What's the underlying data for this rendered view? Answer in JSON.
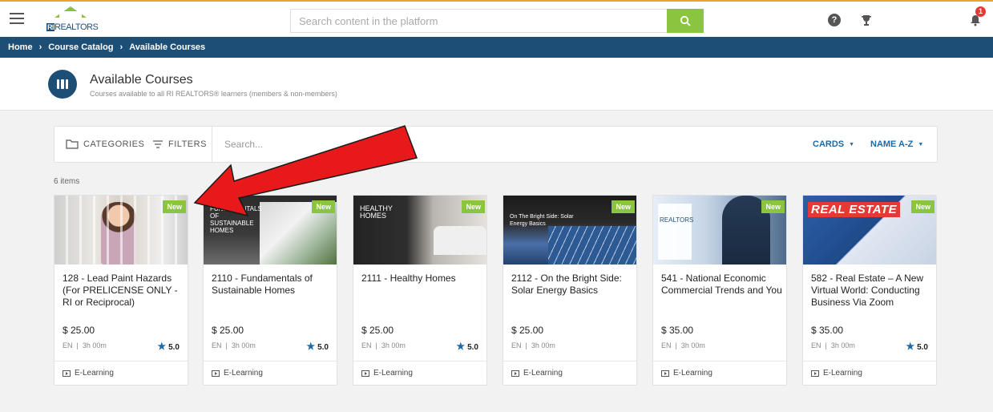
{
  "header": {
    "logo_text": "REALTORS",
    "search_placeholder": "Search content in the platform",
    "notification_count": "1"
  },
  "breadcrumb": [
    "Home",
    "Course Catalog",
    "Available Courses"
  ],
  "page": {
    "title": "Available Courses",
    "subtitle": "Courses available to all RI REALTORS® learners (members & non-members)"
  },
  "toolbar": {
    "categories": "CATEGORIES",
    "filters": "FILTERS",
    "search_placeholder": "Search...",
    "view": "CARDS",
    "sort": "NAME A-Z"
  },
  "items_count": "6 items",
  "cards": [
    {
      "badge": "New",
      "title": "128 - Lead Paint Hazards (For PRELICENSE ONLY - RI or Reciprocal)",
      "price": "$ 25.00",
      "lang": "EN",
      "duration": "3h 00m",
      "rating": "5.0",
      "type": "E-Learning",
      "thumb_text": ""
    },
    {
      "badge": "New",
      "title": "2110 - Fundamentals of Sustainable Homes",
      "price": "$ 25.00",
      "lang": "EN",
      "duration": "3h 00m",
      "rating": "5.0",
      "type": "E-Learning",
      "thumb_text": "Fundamentals of Sustainable Homes"
    },
    {
      "badge": "New",
      "title": "2111 - Healthy Homes",
      "price": "$ 25.00",
      "lang": "EN",
      "duration": "3h 00m",
      "rating": "5.0",
      "type": "E-Learning",
      "thumb_text": "Healthy Homes"
    },
    {
      "badge": "New",
      "title": "2112 - On the Bright Side: Solar Energy Basics",
      "price": "$ 25.00",
      "lang": "EN",
      "duration": "3h 00m",
      "rating": "",
      "type": "E-Learning",
      "thumb_text": "On The Bright Side: Solar Energy Basics"
    },
    {
      "badge": "New",
      "title": "541 - National Economic Commercial Trends and You",
      "price": "$ 35.00",
      "lang": "EN",
      "duration": "3h 00m",
      "rating": "",
      "type": "E-Learning",
      "thumb_text": "REALTORS"
    },
    {
      "badge": "New",
      "title": "582 - Real Estate – A New Virtual World: Conducting Business Via Zoom",
      "price": "$ 35.00",
      "lang": "EN",
      "duration": "3h 00m",
      "rating": "5.0",
      "type": "E-Learning",
      "thumb_text": "REAL ESTATE"
    }
  ],
  "colors": {
    "brand_navy": "#1c4e76",
    "accent_green": "#8bc53f",
    "link_blue": "#1c6aa8",
    "arrow_red": "#e8191a"
  },
  "icons": [
    "menu-icon",
    "search-icon",
    "help-icon",
    "trophy-icon",
    "bell-icon",
    "folder-icon",
    "filter-icon",
    "star-icon",
    "e-learning-icon",
    "arrow-annotation"
  ]
}
